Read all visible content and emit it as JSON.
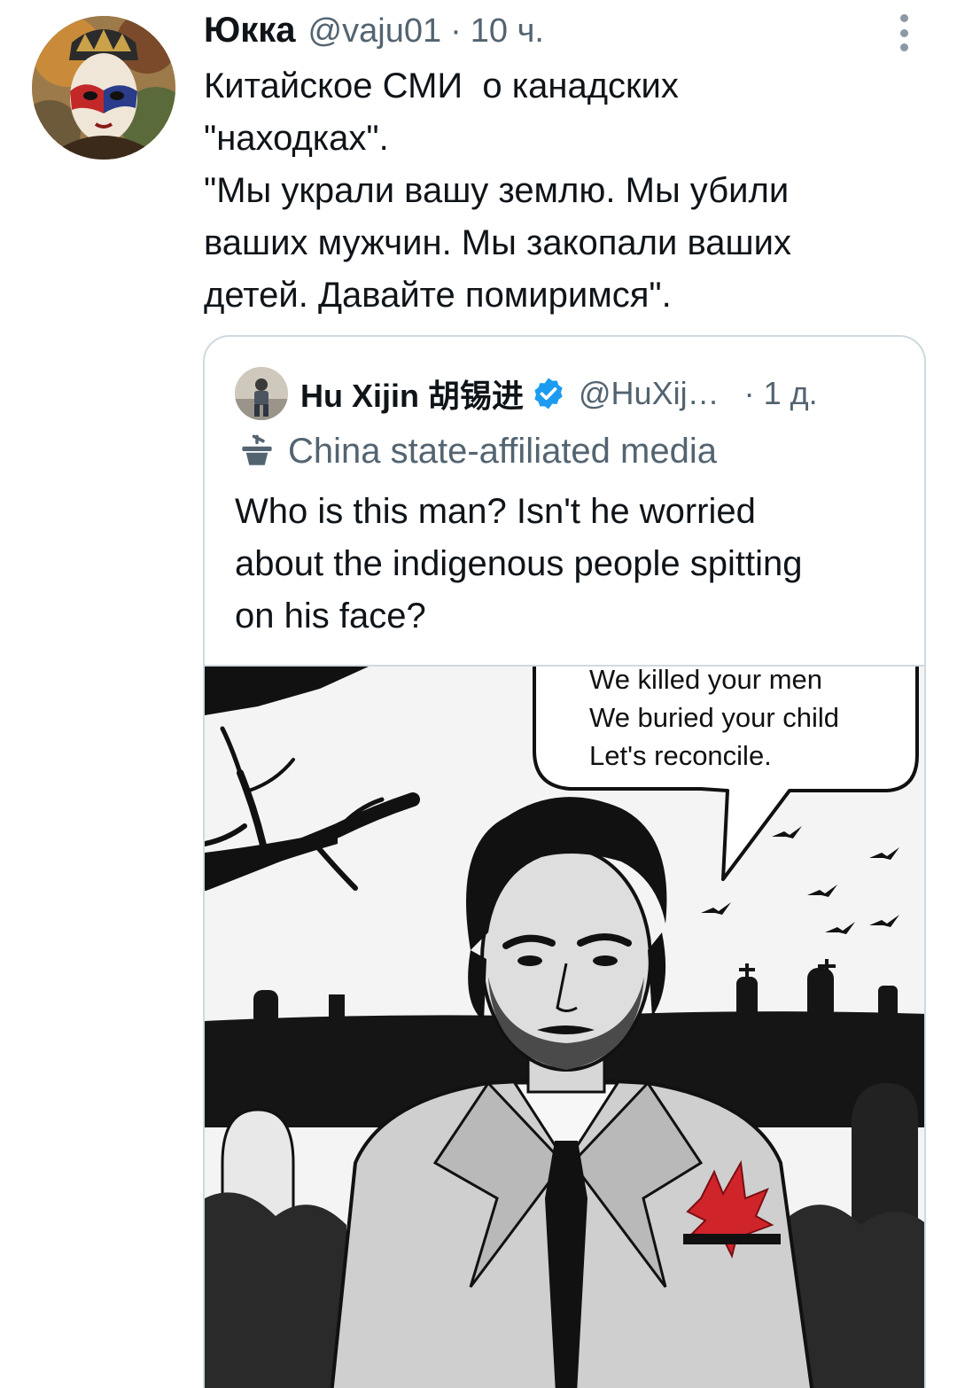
{
  "tweet": {
    "author_name": "Юкка",
    "author_handle": "@vaju01",
    "separator": "·",
    "time": "10 ч.",
    "avatar_icon": "venetian-mask-avatar",
    "more_icon": "more-vertical-icon",
    "text_lines": [
      "Китайское СМИ  о канадских",
      "\"находках\".",
      "\"Мы украли вашу землю. Мы убили",
      "ваших мужчин. Мы закопали ваших",
      "детей. Давайте помиримся\"."
    ]
  },
  "quoted": {
    "author_name": "Hu Xijin 胡锡进",
    "author_handle": "@HuXij…",
    "separator": "·",
    "time": "1 д.",
    "verified_icon": "verified-badge-icon",
    "label_icon": "podium-icon",
    "label": "China state-affiliated media",
    "text_lines": [
      "Who is this man? Isn't he worried",
      "about the indigenous people spitting",
      "on his face?"
    ],
    "media": {
      "speech_bubble_lines": [
        "We killed your men",
        "We buried your child",
        "Let's reconcile."
      ],
      "accent_color": "#d0242b"
    }
  },
  "colors": {
    "text_primary": "#0f1419",
    "text_secondary": "#536471",
    "border": "#cfd9de",
    "verified": "#1d9bf0"
  }
}
